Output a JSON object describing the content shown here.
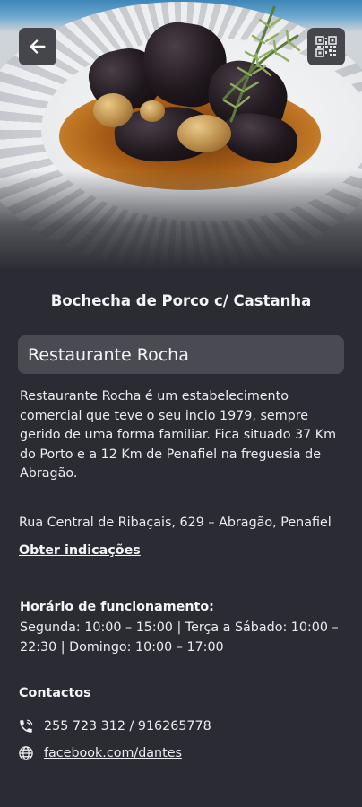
{
  "header": {
    "back_icon": "arrow-left-icon",
    "qr_icon": "qr-code-icon"
  },
  "dish": {
    "title": "Bochecha de Porco c/ Castanha"
  },
  "restaurant": {
    "name": "Restaurante Rocha",
    "description": "Restaurante Rocha é um estabelecimento comercial que teve o seu incio 1979, sempre gerido de uma forma familiar. Fica situado 37 Km do Porto e a 12 Km de Penafiel na freguesia de Abragão.",
    "address": "Rua Central de Ribaçais, 629 – Abragão, Penafiel",
    "directions_label": "Obter indicações"
  },
  "hours": {
    "label": "Horário de funcionamento:",
    "text": "Segunda: 10:00 – 15:00 | Terça a Sábado: 10:00 – 22:30 | Domingo: 10:00 – 17:00"
  },
  "contacts": {
    "label": "Contactos",
    "phone": "255 723 312 / 916265778",
    "phone_icon": "phone-icon",
    "website": "facebook.com/dantes",
    "website_icon": "globe-icon"
  },
  "colors": {
    "background": "#2b2c33",
    "card": "#4a4b52",
    "button": "#45464c",
    "text": "#f2f2f4"
  }
}
